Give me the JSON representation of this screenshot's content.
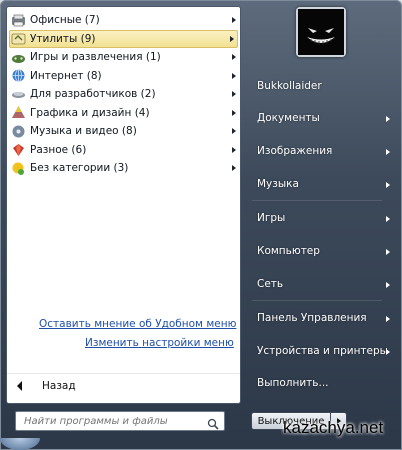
{
  "programs": [
    {
      "label": "Офисные (7)",
      "icon": "office-icon",
      "selected": false
    },
    {
      "label": "Утилиты (9)",
      "icon": "utilities-icon",
      "selected": true
    },
    {
      "label": "Игры и развлечения (1)",
      "icon": "games-icon",
      "selected": false
    },
    {
      "label": "Интернет (8)",
      "icon": "internet-icon",
      "selected": false
    },
    {
      "label": "Для разработчиков (2)",
      "icon": "developer-icon",
      "selected": false
    },
    {
      "label": "Графика и дизайн (4)",
      "icon": "graphics-icon",
      "selected": false
    },
    {
      "label": "Музыка и видео (8)",
      "icon": "media-icon",
      "selected": false
    },
    {
      "label": "Разное (6)",
      "icon": "misc-icon",
      "selected": false
    },
    {
      "label": "Без категории (3)",
      "icon": "uncategorized-icon",
      "selected": false
    }
  ],
  "links": {
    "feedback": "Оставить мнение об Удобном меню",
    "settings": "Изменить настройки меню"
  },
  "back_label": "Назад",
  "search": {
    "placeholder": "Найти программы и файлы"
  },
  "right_items": [
    {
      "label": "Bukkollaider",
      "has_arrow": false
    },
    {
      "label": "Документы",
      "has_arrow": true
    },
    {
      "label": "Изображения",
      "has_arrow": true
    },
    {
      "label": "Музыка",
      "has_arrow": true
    },
    {
      "label": "Игры",
      "has_arrow": true
    },
    {
      "label": "Компьютер",
      "has_arrow": true
    },
    {
      "label": "Сеть",
      "has_arrow": true
    },
    {
      "label": "Панель Управления",
      "has_arrow": true
    },
    {
      "label": "Устройства и принтеры",
      "has_arrow": true
    },
    {
      "label": "Выполнить...",
      "has_arrow": false
    }
  ],
  "shutdown_label": "Выключение",
  "watermark": "kazachya.net"
}
